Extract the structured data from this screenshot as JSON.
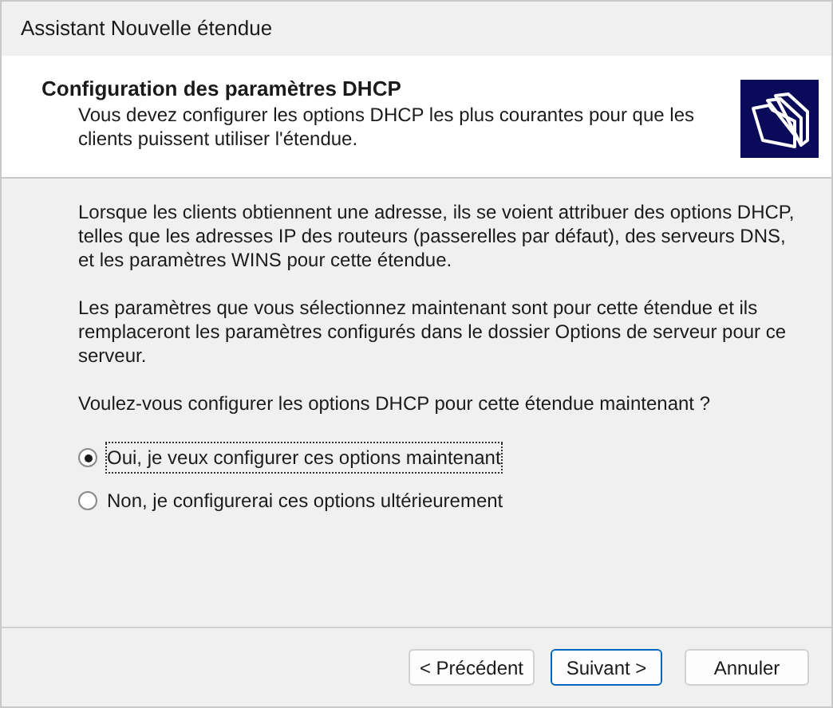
{
  "window": {
    "title": "Assistant Nouvelle étendue"
  },
  "header": {
    "title": "Configuration des paramètres DHCP",
    "subtitle": "Vous devez configurer les options DHCP les plus courantes pour que les clients puissent utiliser l'étendue."
  },
  "paragraphs": [
    "Lorsque les clients obtiennent une adresse, ils se voient attribuer des options DHCP, telles que les adresses IP des routeurs (passerelles par défaut), des serveurs DNS, et les paramètres WINS pour cette étendue.",
    "Les paramètres que vous sélectionnez maintenant sont pour cette étendue et ils remplaceront les paramètres configurés dans le dossier Options de serveur pour ce serveur.",
    "Voulez-vous configurer les options DHCP pour cette étendue maintenant ?"
  ],
  "options": [
    {
      "label": "Oui, je veux configurer ces options maintenant",
      "selected": true
    },
    {
      "label": "Non, je configurerai ces options ultérieurement",
      "selected": false
    }
  ],
  "buttons": [
    {
      "label": "< Précédent",
      "default": false
    },
    {
      "label": "Suivant >",
      "default": true
    },
    {
      "label": "Annuler",
      "default": false
    }
  ]
}
